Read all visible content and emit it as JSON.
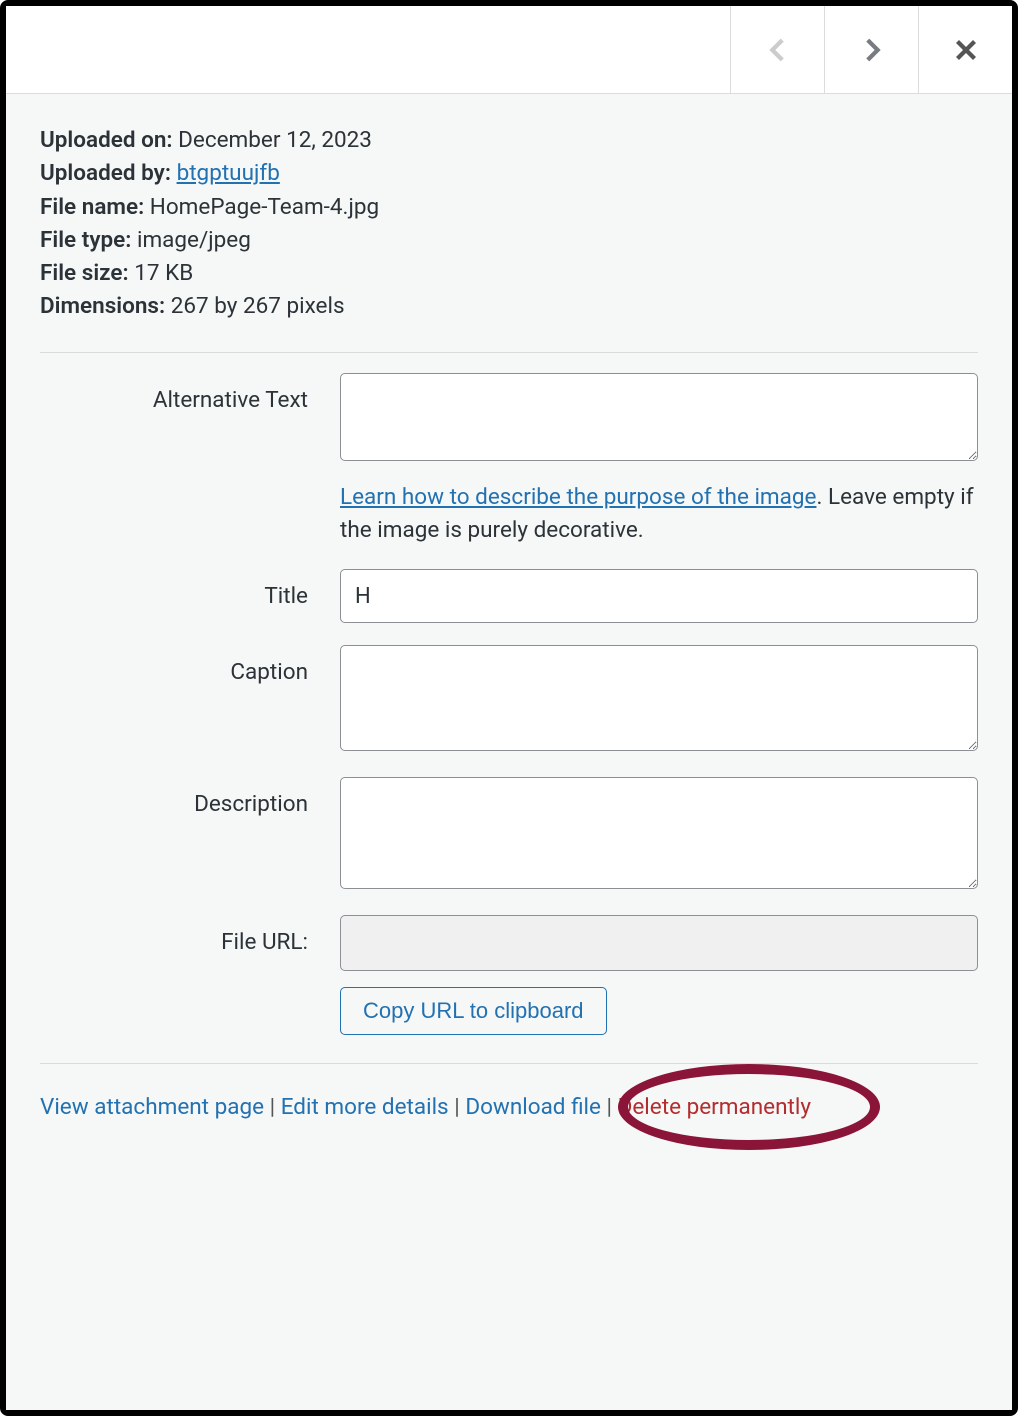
{
  "meta": {
    "uploaded_on_label": "Uploaded on:",
    "uploaded_on": "December 12, 2023",
    "uploaded_by_label": "Uploaded by:",
    "uploaded_by": "btgptuujfb",
    "file_name_label": "File name:",
    "file_name": "HomePage-Team-4.jpg",
    "file_type_label": "File type:",
    "file_type": "image/jpeg",
    "file_size_label": "File size:",
    "file_size": "17 KB",
    "dimensions_label": "Dimensions:",
    "dimensions": "267 by 267 pixels"
  },
  "fields": {
    "alt_label": "Alternative Text",
    "alt_value": "",
    "alt_help_link": "Learn how to describe the purpose of the image",
    "alt_help_period": ".",
    "alt_help_text": "Leave empty if the image is purely decorative.",
    "title_label": "Title",
    "title_value": "H",
    "caption_label": "Caption",
    "caption_value": "",
    "description_label": "Description",
    "description_value": "",
    "file_url_label": "File URL:",
    "file_url_value": "",
    "copy_button": "Copy URL to clipboard"
  },
  "actions": {
    "view": "View attachment page",
    "edit": "Edit more details",
    "download": "Download file",
    "delete": "Delete permanently",
    "sep": " | "
  }
}
